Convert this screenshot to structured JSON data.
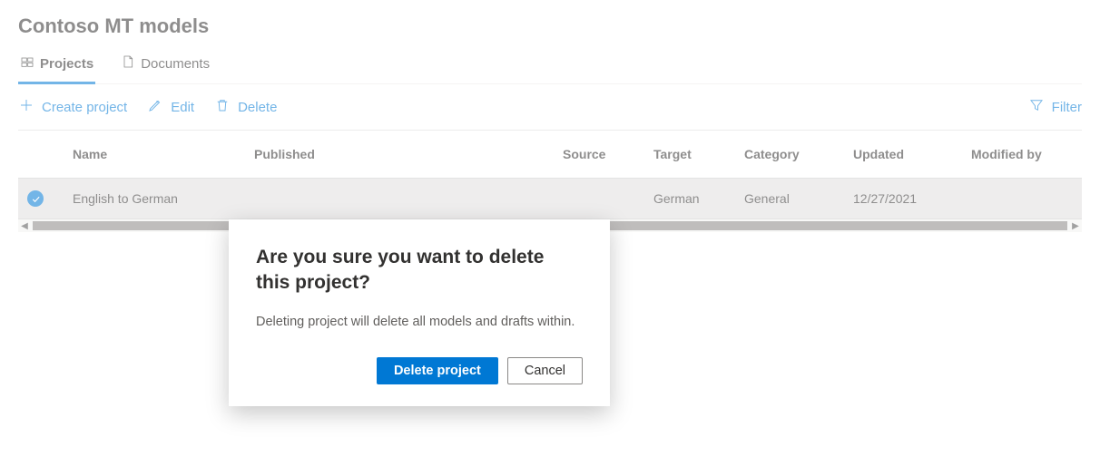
{
  "header": {
    "title": "Contoso MT models"
  },
  "tabs": {
    "items": [
      {
        "label": "Projects",
        "active": true
      },
      {
        "label": "Documents",
        "active": false
      }
    ]
  },
  "commands": {
    "create": "Create project",
    "edit": "Edit",
    "delete": "Delete",
    "filter": "Filter"
  },
  "table": {
    "columns": {
      "name": "Name",
      "published": "Published",
      "source": "Source",
      "target": "Target",
      "category": "Category",
      "updated": "Updated",
      "modified_by": "Modified by"
    },
    "rows": [
      {
        "selected": true,
        "name": "English to German",
        "published": "",
        "source": "",
        "target": "German",
        "category": "General",
        "updated": "12/27/2021",
        "modified_by": ""
      }
    ]
  },
  "dialog": {
    "title": "Are you sure you want to delete this project?",
    "body": "Deleting project will delete all models and drafts within.",
    "primary": "Delete project",
    "secondary": "Cancel"
  }
}
